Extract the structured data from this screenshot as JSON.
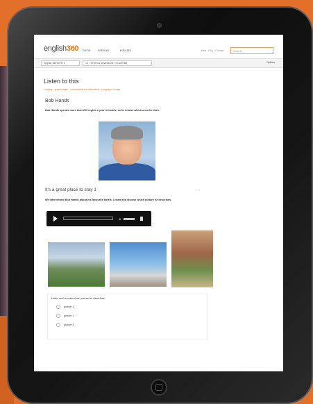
{
  "site": {
    "logo_prefix": "english",
    "logo_suffix": "360"
  },
  "nav": {
    "items": [
      "home",
      "services",
      "educate"
    ]
  },
  "top_links": "Help · FAQ · Contact",
  "search": {
    "placeholder": "Search"
  },
  "tabs": [
    {
      "label": "English 360 Level 1"
    },
    {
      "label": "10 - Tenemos la sabiduría: Lecture title"
    }
  ],
  "tab_options": "Options",
  "page": {
    "title": "Listen to this",
    "breadcrumb": "Lodging · great budget · comfortable and affordable · Lodging in Hotels",
    "section1": {
      "heading": "Bob Hands",
      "text": "Bob Hands spends more than 200 nights a year in hotels, so he knows which ones he likes."
    },
    "section2": {
      "heading": "It's a great place to stay 1",
      "text": "We interviewed Bob Hands about his favourite hotels. Listen and choose which picture he describes."
    }
  },
  "quiz": {
    "question": "Listen and choose which picture he describes",
    "options": [
      "picture 1",
      "picture 2",
      "picture 3"
    ]
  }
}
